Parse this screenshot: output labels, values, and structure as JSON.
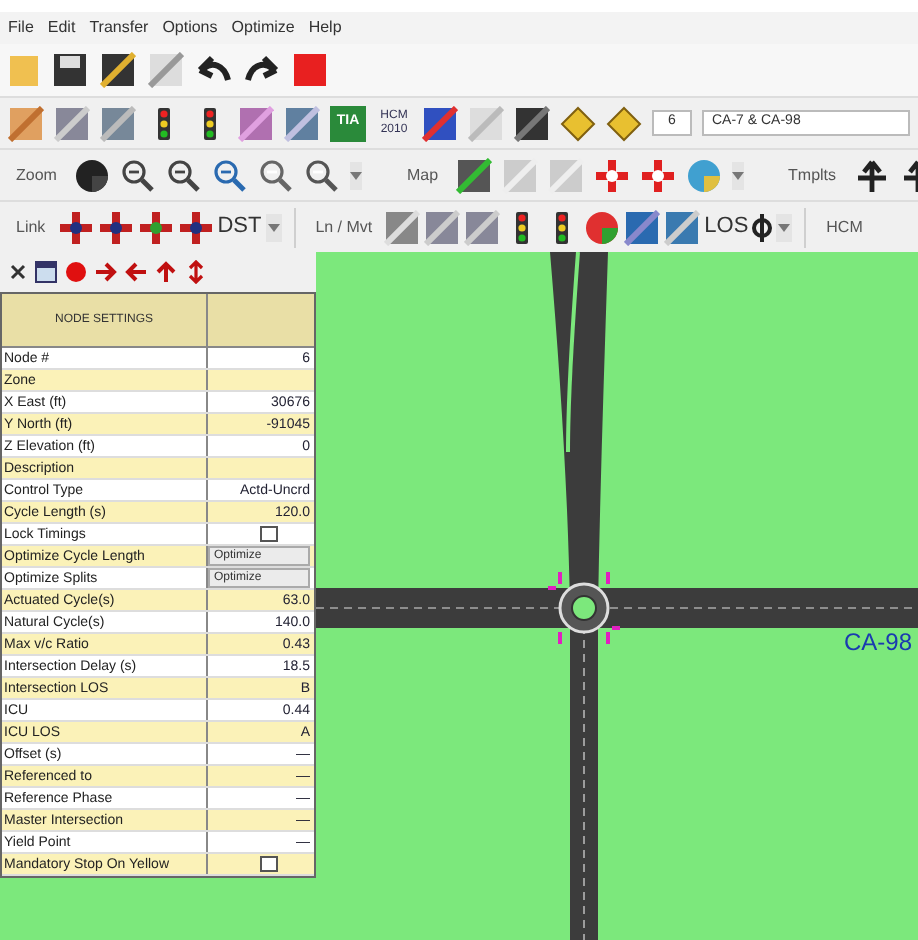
{
  "menu": [
    "File",
    "Edit",
    "Transfer",
    "Options",
    "Optimize",
    "Help"
  ],
  "toolbar_2": {
    "hcm_badge": "HCM 2010",
    "tia_badge": "TIA",
    "node_number": "6",
    "node_name": "CA-7 & CA-98"
  },
  "toolbar_3": {
    "zoom_label": "Zoom",
    "map_label": "Map",
    "templates_label": "Tmplts"
  },
  "toolbar_4": {
    "link_label": "Link",
    "dst_label": "DST",
    "lane_label": "Ln / Mvt",
    "los_label": "LOS",
    "hcm_label": "HCM"
  },
  "node_settings": {
    "title": "NODE SETTINGS",
    "rows": [
      {
        "label": "Node #",
        "kind": "text",
        "value": "6"
      },
      {
        "label": "Zone",
        "kind": "text",
        "value": ""
      },
      {
        "label": "X East (ft)",
        "kind": "text",
        "value": "30676"
      },
      {
        "label": "Y North (ft)",
        "kind": "text",
        "value": "-91045"
      },
      {
        "label": "Z Elevation (ft)",
        "kind": "text",
        "value": "0"
      },
      {
        "label": "Description",
        "kind": "text",
        "value": ""
      },
      {
        "label": "Control Type",
        "kind": "text",
        "value": "Actd-Uncrd"
      },
      {
        "label": "Cycle Length (s)",
        "kind": "text",
        "value": "120.0"
      },
      {
        "label": "Lock Timings",
        "kind": "checkbox",
        "checked": false
      },
      {
        "label": "Optimize Cycle Length",
        "kind": "button",
        "value": "Optimize"
      },
      {
        "label": "Optimize Splits",
        "kind": "button",
        "value": "Optimize"
      },
      {
        "label": "Actuated Cycle(s)",
        "kind": "text",
        "value": "63.0"
      },
      {
        "label": "Natural Cycle(s)",
        "kind": "text",
        "value": "140.0"
      },
      {
        "label": "Max v/c Ratio",
        "kind": "text",
        "value": "0.43"
      },
      {
        "label": "Intersection Delay (s)",
        "kind": "text",
        "value": "18.5"
      },
      {
        "label": "Intersection LOS",
        "kind": "text",
        "value": "B"
      },
      {
        "label": "ICU",
        "kind": "text",
        "value": "0.44"
      },
      {
        "label": "ICU LOS",
        "kind": "text",
        "value": "A"
      },
      {
        "label": "Offset (s)",
        "kind": "text",
        "value": "—"
      },
      {
        "label": "Referenced to",
        "kind": "text",
        "value": "—"
      },
      {
        "label": "Reference Phase",
        "kind": "text",
        "value": "—"
      },
      {
        "label": "Master Intersection",
        "kind": "text",
        "value": "—"
      },
      {
        "label": "Yield Point",
        "kind": "text",
        "value": "—"
      },
      {
        "label": "Mandatory Stop On Yellow",
        "kind": "checkbox",
        "checked": false
      }
    ]
  },
  "map": {
    "street_label": "CA-98"
  }
}
